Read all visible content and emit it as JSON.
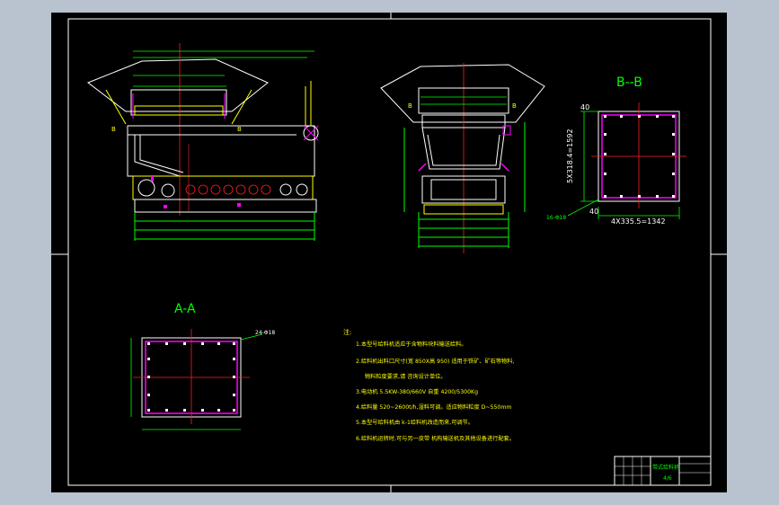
{
  "section_labels": {
    "bb": "B--B",
    "aa": "A-A"
  },
  "view_markers": {
    "b_left": "B",
    "b_right": "B",
    "b2_left": "B",
    "b2_right": "B"
  },
  "bb_view": {
    "dim_top": "40",
    "dim_vertical": "5X318.4=1592",
    "dim_corner": "40",
    "dim_horizontal": "4X335.5=1342",
    "callout": "16-Φ18"
  },
  "aa_view": {
    "callout": "24-Φ18"
  },
  "notes": {
    "heading": "注:",
    "items": [
      "1.本型号给料机适应于含物料块料输送给料。",
      "2.给料机出料口尺寸(宽 850X高 950) 适用于铁矿、矿石等物料,",
      "物料粒度要求,请 咨询设计单位。",
      "3.电动机 5.5KW-380/660V 自重 4200/5300Kg",
      "4.给料量 520~2600t/h,湿料可调。适应物料粒度 D~550mm",
      "5.本型号给料机由 k-1给料机改造而来,可调节。",
      "6.给料机运转时,可与另一皮带 机构输送机及其他设备进行配套。"
    ]
  },
  "title_block": {
    "name": "带式给料机",
    "code": "4/6"
  }
}
